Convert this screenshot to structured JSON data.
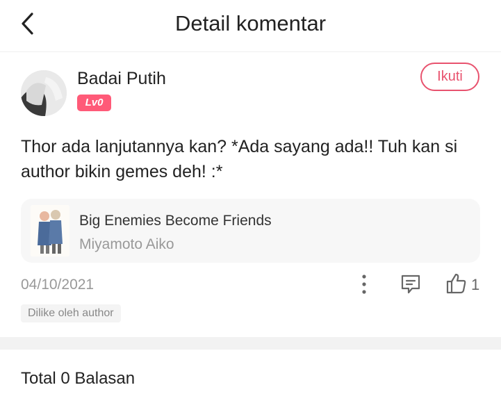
{
  "header": {
    "title": "Detail komentar",
    "back_icon": "chevron-left-icon"
  },
  "comment": {
    "username": "Badai Putih",
    "level": "Lv0",
    "follow_label": "Ikuti",
    "text": "Thor ada lanjutannya kan? *Ada sayang ada!! Tuh kan si author bikin gemes deh! :*",
    "date": "04/10/2021",
    "like_count": "1",
    "liked_by_author": "Dilike oleh author"
  },
  "book": {
    "title": "Big Enemies Become Friends",
    "author": "Miyamoto Aiko"
  },
  "replies": {
    "total_label": "Total 0 Balasan"
  },
  "colors": {
    "accent": "#e8526e",
    "level_badge": "#ff5a78",
    "muted_text": "#999999",
    "card_bg": "#f7f7f7"
  }
}
